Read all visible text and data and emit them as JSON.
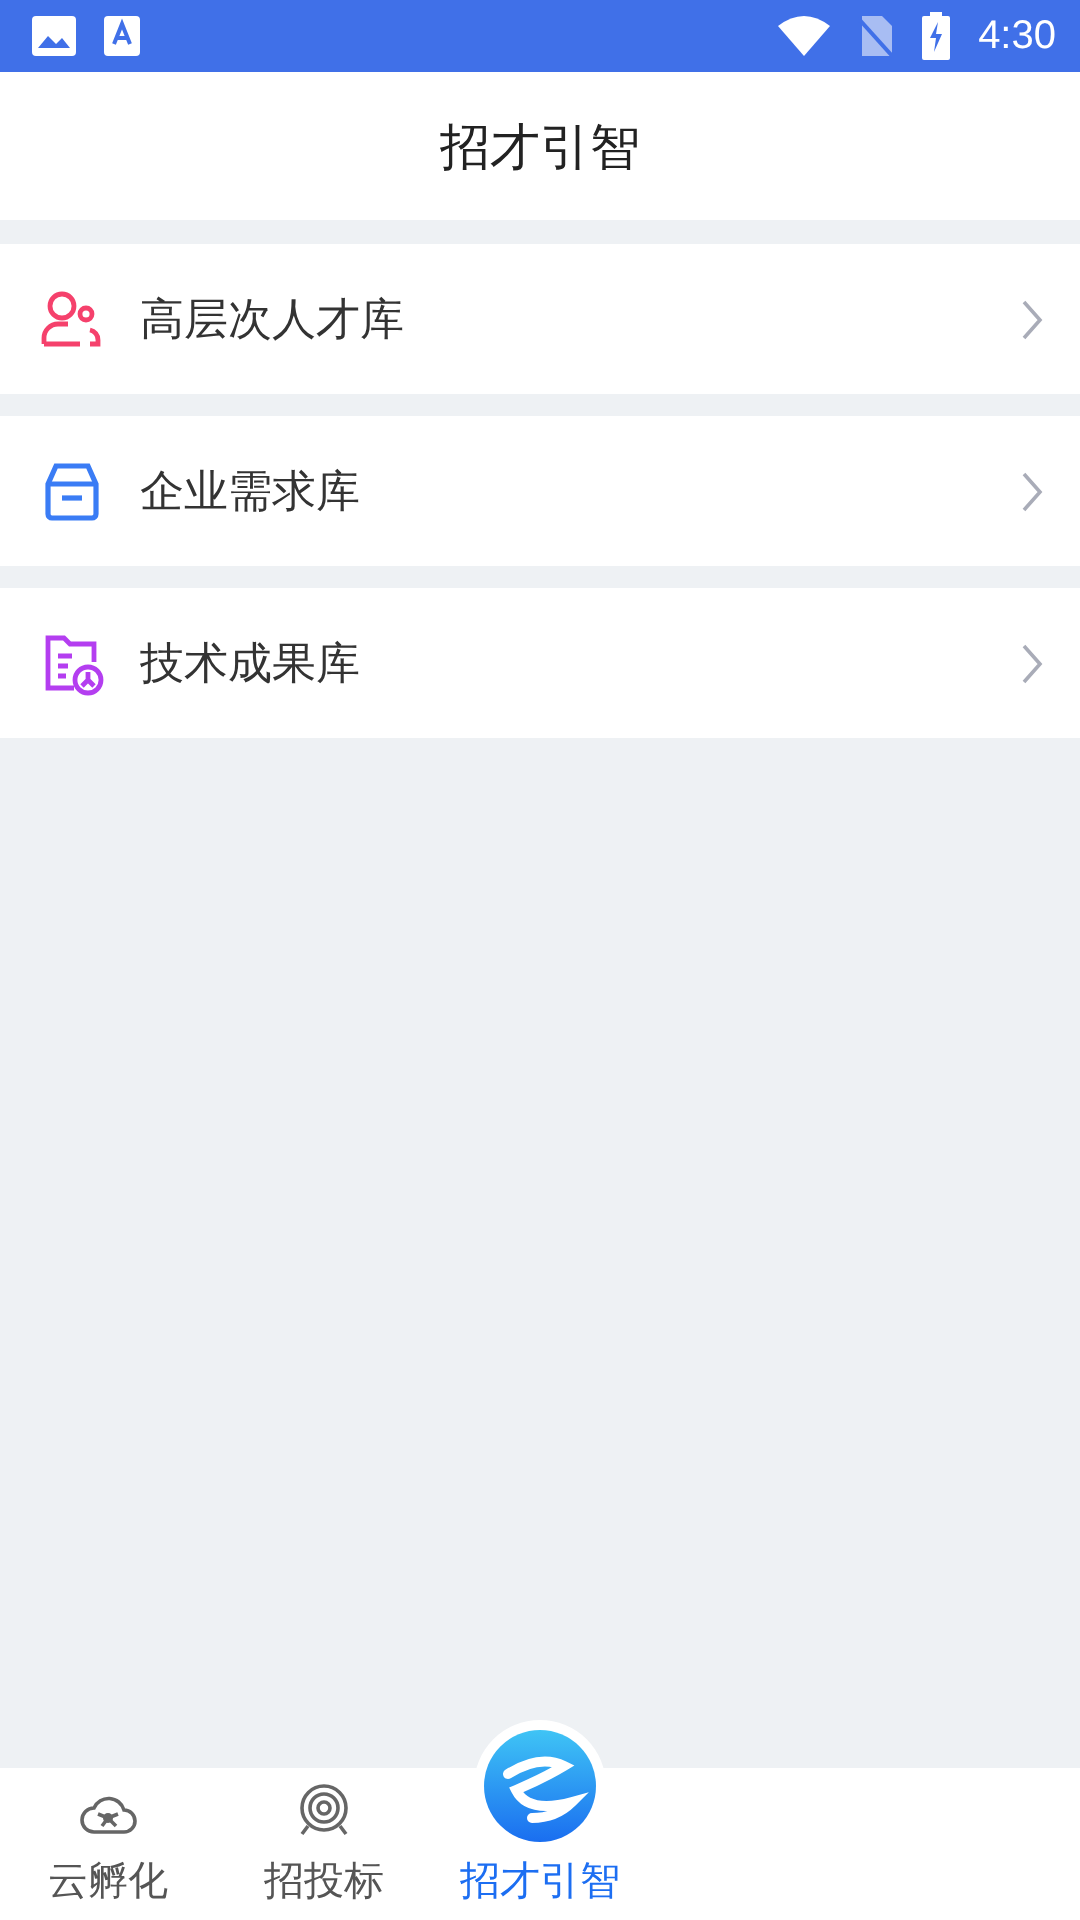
{
  "status_bar": {
    "time": "4:30"
  },
  "header": {
    "title": "招才引智"
  },
  "menu": [
    {
      "label": "高层次人才库",
      "color": "#f5416c"
    },
    {
      "label": "企业需求库",
      "color": "#3a7cf5"
    },
    {
      "label": "技术成果库",
      "color": "#b43ef0"
    }
  ],
  "tabs": [
    {
      "label": "云孵化",
      "kind": "icon",
      "selected": false
    },
    {
      "label": "招投标",
      "kind": "icon",
      "selected": false
    },
    {
      "label": "招才引智",
      "kind": "logo",
      "selected": true
    }
  ]
}
